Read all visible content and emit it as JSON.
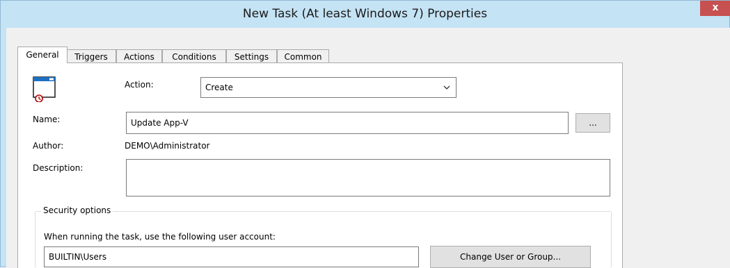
{
  "window": {
    "title": "New Task (At least Windows 7) Properties",
    "close_glyph": "x"
  },
  "tabs": [
    {
      "label": "General",
      "active": true
    },
    {
      "label": "Triggers",
      "active": false
    },
    {
      "label": "Actions",
      "active": false
    },
    {
      "label": "Conditions",
      "active": false
    },
    {
      "label": "Settings",
      "active": false
    },
    {
      "label": "Common",
      "active": false
    }
  ],
  "general": {
    "task_icon": "scheduled-task-icon",
    "action_label": "Action:",
    "action_value": "Create",
    "name_label": "Name:",
    "name_value": "Update App-V",
    "browse_label": "...",
    "author_label": "Author:",
    "author_value": "DEMO\\Administrator",
    "description_label": "Description:",
    "description_value": ""
  },
  "security": {
    "legend": "Security options",
    "account_prompt": "When running the task, use the following user account:",
    "account_value": "BUILTIN\\Users",
    "change_button": "Change User or Group..."
  },
  "colors": {
    "title_bar": "#c4e3f4",
    "close_button": "#c75050",
    "client_bg": "#f0f0f0"
  }
}
